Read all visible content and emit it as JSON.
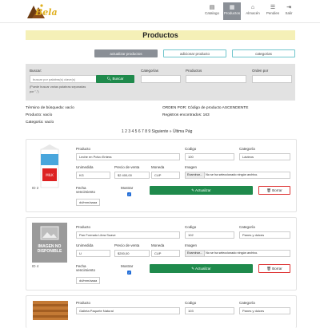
{
  "nav": [
    {
      "label": "Catalogo",
      "icon": "book-icon",
      "glyph": "▤",
      "active": false
    },
    {
      "label": "Productos",
      "icon": "box-icon",
      "glyph": "▦",
      "active": true
    },
    {
      "label": "Almacén",
      "icon": "store-icon",
      "glyph": "⌂",
      "active": false
    },
    {
      "label": "Pendies",
      "icon": "list-icon",
      "glyph": "☰",
      "active": false
    },
    {
      "label": "Salir",
      "icon": "logout-icon",
      "glyph": "⇥",
      "active": false
    }
  ],
  "page_title": "Productos",
  "top_buttons": {
    "update": "actualizar productos",
    "add": "adicionar producto",
    "categories": "categorias"
  },
  "search": {
    "label": "Buscar:",
    "placeholder": "buscar por palabra(s) clave(s)",
    "button": "Buscar",
    "hint1": "(Puede buscar varias palabras separadas",
    "hint2": "por \",\")",
    "categories_label": "Categorías",
    "products_label": "Productos",
    "order_label": "Orden por"
  },
  "info": {
    "term": "Término de búsqueda: vacío",
    "product": "Producto: vacío",
    "category": "Categoría: vacío",
    "order": "ORDEN POR: Código de producto ASCENDENTE",
    "records": "Registros encontrados: 163"
  },
  "pager": "1 2 3 4 5 6 7 8 9 Siguiente » Última Pág",
  "labels": {
    "producto": "Producto",
    "codigo": "Codigo",
    "categoria": "Categoría",
    "unimedida": "Unimedida",
    "precio": "Precio de venta",
    "moneda": "Moneda",
    "imagen": "Imagen",
    "fecha": "Fecha vencimiento",
    "mostrar": "Mostrar",
    "file_btn": "Examinar...",
    "file_text": "No se ha seleccionado ningún archivo.",
    "date_ph": "dd/mm/aaaa",
    "update": "Actualizar",
    "delete": "Borrar"
  },
  "products": [
    {
      "id": "ID 2",
      "name": "Leche en Polvo Entera",
      "code": "100",
      "category": "Lácteos",
      "unit": "KG",
      "price": "$2 400,00",
      "currency": "CUP",
      "mostrar": true,
      "image": "milk"
    },
    {
      "id": "ID 4",
      "name": "Pan Formato Libra Suave",
      "code": "102",
      "category": "Panes y dulces",
      "unit": "U",
      "price": "$200,00",
      "currency": "CUP",
      "mostrar": true,
      "image": "none"
    },
    {
      "id": "ID 6",
      "name": "Galleta Paquete Natural",
      "code": "103",
      "category": "Panes y dulces",
      "unit": "",
      "price": "",
      "currency": "",
      "mostrar": true,
      "image": "bread"
    }
  ],
  "no_image_text": {
    "line1": "IMAGEN NO",
    "line2": "DISPONIBLE"
  },
  "brand_colors": {
    "green": "#1f8a4c",
    "title_bg": "#f5f0b7",
    "teal": "#6fc5cc"
  }
}
